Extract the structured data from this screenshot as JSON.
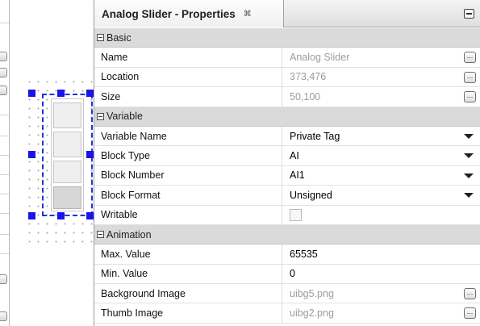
{
  "panel": {
    "title": "Analog Slider - Properties",
    "close_icon": "close-tab-icon",
    "minimize_icon": "minimize-icon"
  },
  "categories": {
    "basic": "Basic",
    "variable": "Variable",
    "animation": "Animation"
  },
  "properties": {
    "name": {
      "label": "Name",
      "value": "Analog Slider"
    },
    "location": {
      "label": "Location",
      "value": "373,476"
    },
    "size": {
      "label": "Size",
      "value": "50,100"
    },
    "var_name": {
      "label": "Variable Name",
      "value": "Private Tag"
    },
    "block_type": {
      "label": "Block Type",
      "value": "AI"
    },
    "block_num": {
      "label": "Block Number",
      "value": "AI1"
    },
    "block_fmt": {
      "label": "Block Format",
      "value": "Unsigned"
    },
    "writable": {
      "label": "Writable",
      "checked": false
    },
    "max_value": {
      "label": "Max. Value",
      "value": "65535"
    },
    "min_value": {
      "label": "Min. Value",
      "value": "0"
    },
    "bg_image": {
      "label": "Background Image",
      "value": "uibg5.png"
    },
    "thumb_image": {
      "label": "Thumb Image",
      "value": "uibg2.png"
    }
  },
  "buttons": {
    "ellipsis": "..."
  },
  "colors": {
    "selection_handles": "#1a14e8",
    "category_background": "#dadada",
    "disabled_text": "#9c9c9c"
  }
}
